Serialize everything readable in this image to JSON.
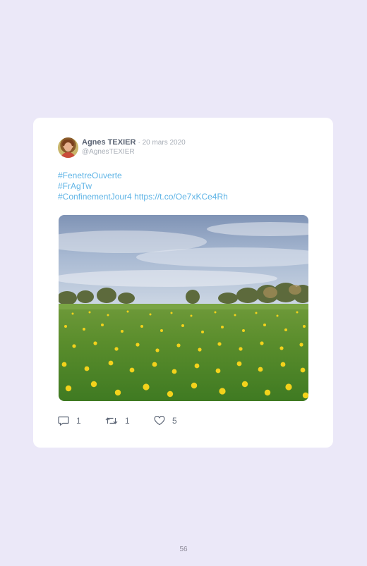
{
  "tweet": {
    "author_name": "Agnes TEXIER",
    "date": "· 20 mars 2020",
    "handle": "@AgnesTEXIER",
    "text_lines": [
      "#FenetreOuverte",
      "#FrAgTw",
      "#ConfinementJour4 https://t.co/Oe7xKCe4Rh"
    ],
    "avatar_icon": "user-photo-icon",
    "photo_description_icon": "dandelion-field-photo"
  },
  "actions": {
    "replies": "1",
    "retweets": "1",
    "likes": "5",
    "icons": [
      "comment-icon",
      "retweet-icon",
      "heart-icon"
    ]
  },
  "page_number": "56",
  "colors": {
    "background": "#ebe8f8",
    "card": "#ffffff",
    "link": "#5fb4e6",
    "name": "#5b6474",
    "muted": "#a7adb6"
  }
}
